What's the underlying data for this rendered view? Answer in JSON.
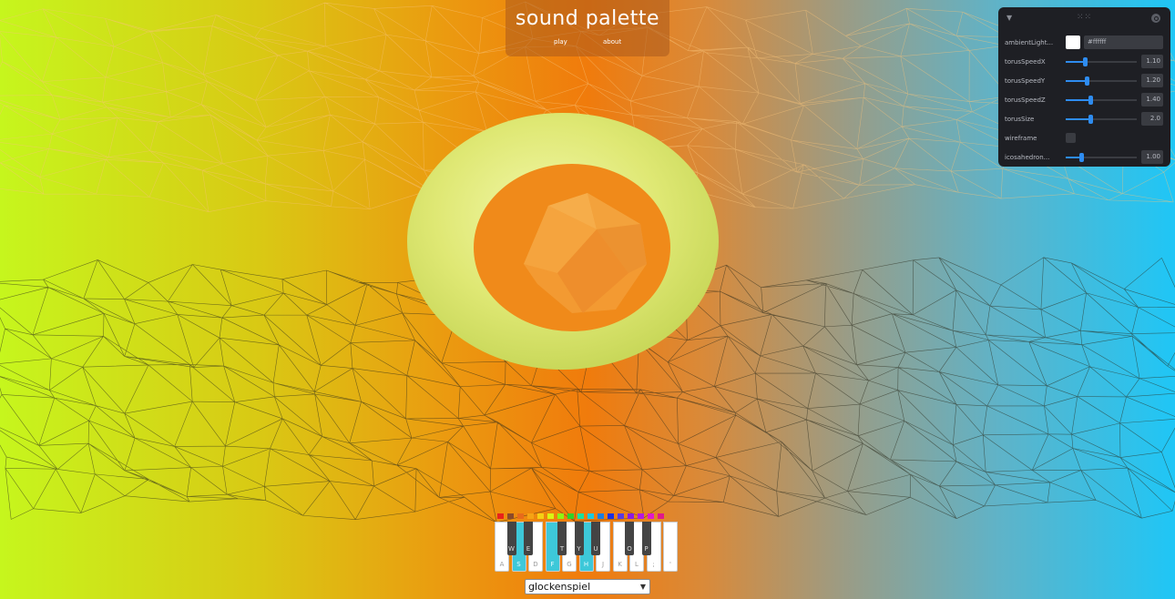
{
  "app": {
    "title": "sound palette",
    "nav": {
      "play": "play",
      "about": "about"
    }
  },
  "gui": {
    "controls": [
      {
        "label": "ambientLight...",
        "type": "color",
        "value": "#ffffff",
        "display": "#ffffff"
      },
      {
        "label": "torusSpeedX",
        "type": "slider",
        "value": "1.10",
        "level": 0.27
      },
      {
        "label": "torusSpeedY",
        "type": "slider",
        "value": "1.20",
        "level": 0.3
      },
      {
        "label": "torusSpeedZ",
        "type": "slider",
        "value": "1.40",
        "level": 0.35
      },
      {
        "label": "torusSize",
        "type": "slider",
        "value": "2.0",
        "level": 0.35
      },
      {
        "label": "wireframe",
        "type": "checkbox",
        "checked": false
      },
      {
        "label": "icosahedron...",
        "type": "slider",
        "value": "1.00",
        "level": 0.22
      }
    ]
  },
  "palette": [
    "#e8221b",
    "#8b4a2a",
    "#e86b1b",
    "#f5a314",
    "#f5d014",
    "#d9f514",
    "#8ef514",
    "#2ed12a",
    "#1be09e",
    "#1bc9e0",
    "#1b7de0",
    "#1b2fe0",
    "#5b3ae0",
    "#8d1be0",
    "#b51be0",
    "#e01bcc",
    "#e01b8a"
  ],
  "piano": {
    "white_keys": [
      {
        "label": "A",
        "highlighted": false
      },
      {
        "label": "S",
        "highlighted": true
      },
      {
        "label": "D",
        "highlighted": false
      },
      {
        "label": "F",
        "highlighted": true
      },
      {
        "label": "G",
        "highlighted": false
      },
      {
        "label": "H",
        "highlighted": true
      },
      {
        "label": "J",
        "highlighted": false
      },
      {
        "label": "K",
        "highlighted": false
      },
      {
        "label": "L",
        "highlighted": false
      },
      {
        "label": ";",
        "highlighted": false
      },
      {
        "label": "'",
        "highlighted": false
      }
    ],
    "black_keys": [
      "W",
      "E",
      "T",
      "Y",
      "U",
      "O",
      "P"
    ]
  },
  "instrument": {
    "selected": "glockenspiel"
  }
}
